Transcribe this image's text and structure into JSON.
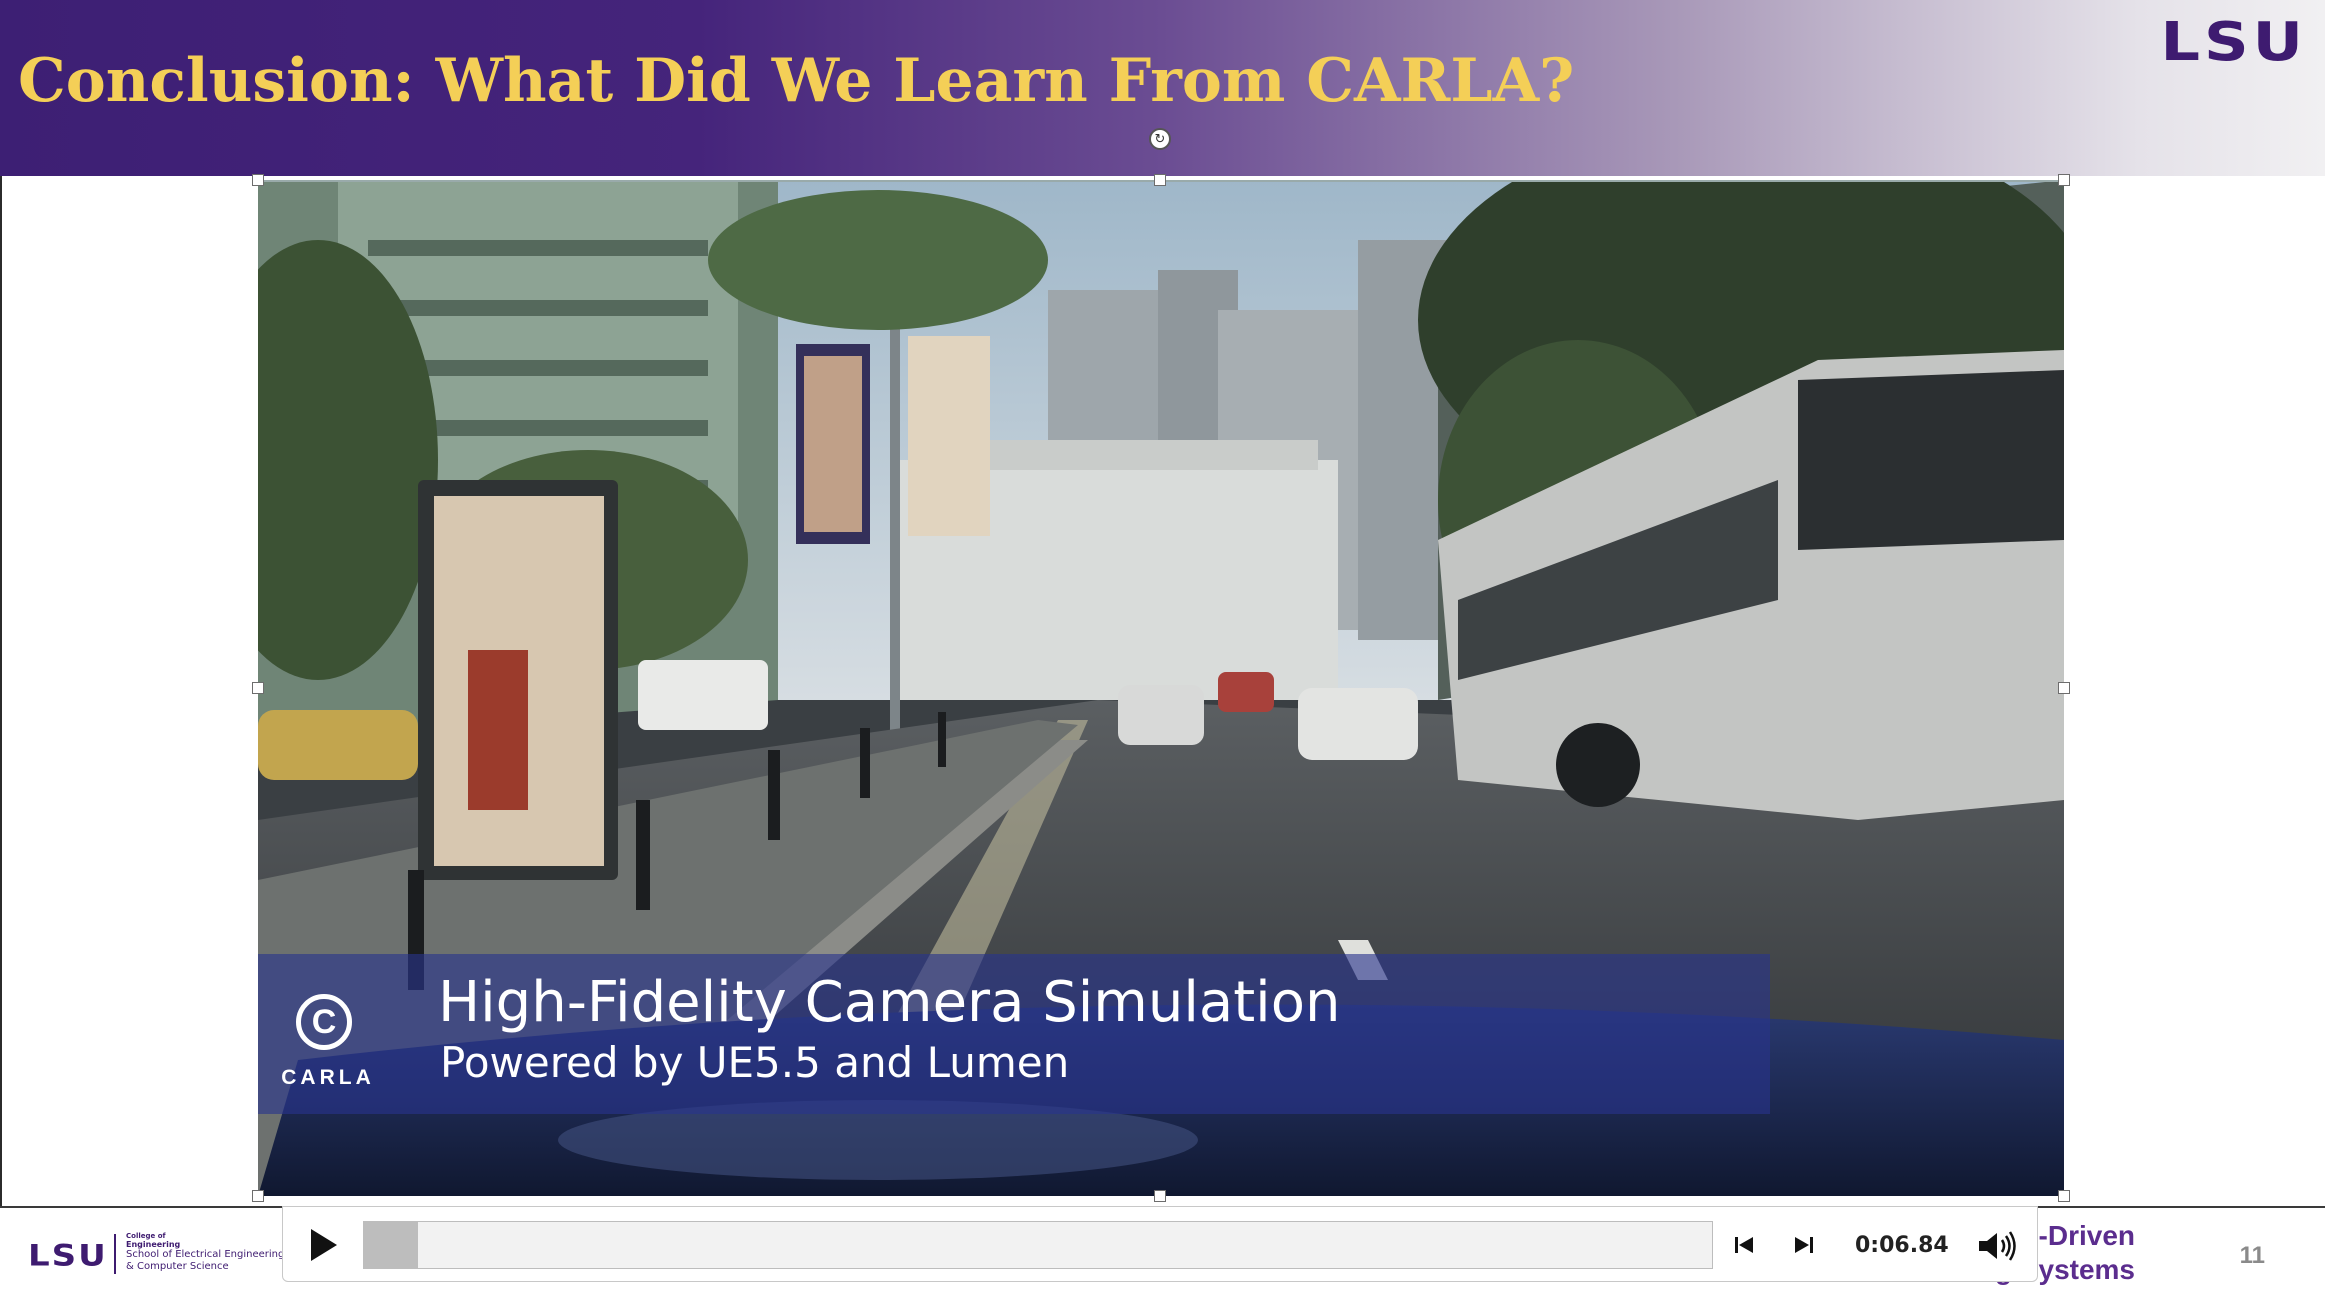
{
  "slide": {
    "title": "Conclusion: What Did We Learn From CARLA?",
    "logo_top": "LSU",
    "page_number": "11"
  },
  "video": {
    "caption_line1": "High-Fidelity Camera Simulation",
    "caption_line2": "Powered by UE5.5 and Lumen",
    "logo_letter": "C",
    "logo_word": "CARLA"
  },
  "footer": {
    "logo": "LSU",
    "college_small": "College of",
    "college_name": "Engineering",
    "school_line1": "School of Electrical Engineering",
    "school_line2": "& Computer Science",
    "course_line1": "-Driven",
    "course_line2": "ng Systems"
  },
  "player": {
    "current_time": "0:06.84",
    "progress": 0.04,
    "play_icon": "play-icon",
    "back_icon": "step-back-icon",
    "forward_icon": "step-forward-icon",
    "volume_icon": "volume-icon"
  },
  "colors": {
    "title": "#f4cf57",
    "lsu_purple": "#3e1b70",
    "banner_start": "#3d1f74",
    "banner_end": "#f1f0f2"
  }
}
